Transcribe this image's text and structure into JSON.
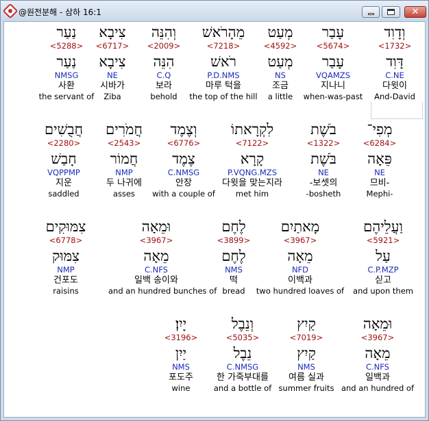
{
  "window": {
    "title": "@원전분해 - 삼하 16:1",
    "icon": "app-diamond-icon",
    "buttons": {
      "minimize": "minimize-icon",
      "maximize": "maximize-icon",
      "close": "close-icon",
      "close_glyph": "✕"
    }
  },
  "rows": [
    {
      "words": [
        {
          "heb1": "וְדָוִד",
          "strong": "<1732>",
          "heb2": "דָּוִד",
          "morph": "C.NE",
          "kor": "다윗이",
          "eng": "And-David",
          "selected": true
        },
        {
          "heb1": "עָבַר",
          "strong": "<5674>",
          "heb2": "עָבַר",
          "morph": "VQAMZS",
          "kor": "지나니",
          "eng": "when-was-past"
        },
        {
          "heb1": "מְעַט",
          "strong": "<4592>",
          "heb2": "מְעַט",
          "morph": "NS",
          "kor": "조금",
          "eng": "a little"
        },
        {
          "heb1": "מֵהָרֹאשׁ",
          "strong": "<7218>",
          "heb2": "רֹאשׁ",
          "morph": "P.D.NMS",
          "kor": "마루 턱을",
          "eng": "the top of the hill"
        },
        {
          "heb1": "וְהִנֵּה",
          "strong": "<2009>",
          "heb2": "הִנֵּה",
          "morph": "C.Q",
          "kor": "보라",
          "eng": "behold"
        },
        {
          "heb1": "צִיבָא",
          "strong": "<6717>",
          "heb2": "צִיבָא",
          "morph": "NE",
          "kor": "시바가",
          "eng": "Ziba"
        },
        {
          "heb1": "נַעַר",
          "strong": "<5288>",
          "heb2": "נַעַר",
          "morph": "NMSG",
          "kor": "사환",
          "eng": "the servant of"
        }
      ]
    },
    {
      "words": [
        {
          "heb1": "מְפִי־",
          "strong": "<6284>",
          "heb2": "פֵּאָה",
          "morph": "NE",
          "kor": "므비-",
          "eng": "Mephi-"
        },
        {
          "heb1": "בֹשֶׁת",
          "strong": "<1322>",
          "heb2": "בֹּשֶׁת",
          "morph": "NE",
          "kor": "-보셋의",
          "eng": "-bosheth"
        },
        {
          "heb1": "לִקְרָאתוֹ",
          "strong": "<7122>",
          "heb2": "קָרָא",
          "morph": "P.VQNG.MZS",
          "kor": "다윗을 맞는지라",
          "eng": "met him"
        },
        {
          "heb1": "וְצֶמֶד",
          "strong": "<6776>",
          "heb2": "צֶמֶד",
          "morph": "C.NMSG",
          "kor": "안장",
          "eng": "with a couple of"
        },
        {
          "heb1": "חֲמֹרִים",
          "strong": "<2543>",
          "heb2": "חֲמוֹר",
          "morph": "NMP",
          "kor": "두 나귀에",
          "eng": "asses"
        },
        {
          "heb1": "חֲבֻשִׁים",
          "strong": "<2280>",
          "heb2": "חָבַשׁ",
          "morph": "VQPPMP",
          "kor": "지운",
          "eng": "saddled"
        }
      ]
    },
    {
      "words": [
        {
          "heb1": "וַעֲלֵיהֶם",
          "strong": "<5921>",
          "heb2": "עַל",
          "morph": "C.P.MZP",
          "kor": "싣고",
          "eng": "and upon them"
        },
        {
          "heb1": "מָאתַיִם",
          "strong": "<3967>",
          "heb2": "מֵאָה",
          "morph": "NFD",
          "kor": "이백과",
          "eng": "two hundred loaves of"
        },
        {
          "heb1": "לֶחֶם",
          "strong": "<3899>",
          "heb2": "לֶחֶם",
          "morph": "NMS",
          "kor": "떡",
          "eng": "bread"
        },
        {
          "heb1": "וּמֵאָה",
          "strong": "<3967>",
          "heb2": "מֵאָה",
          "morph": "C.NFS",
          "kor": "일백 송이와",
          "eng": "and an hundred bunches of"
        },
        {
          "heb1": "צִמּוּקִים",
          "strong": "<6778>",
          "heb2": "צִמּוּק",
          "morph": "NMP",
          "kor": "건포도",
          "eng": "raisins"
        }
      ]
    },
    {
      "words": [
        {
          "heb1": "וּמֵאָה",
          "strong": "<3967>",
          "heb2": "מֵאָה",
          "morph": "C.NFS",
          "kor": "일백과",
          "eng": "and an hundred of"
        },
        {
          "heb1": "קַיִץ",
          "strong": "<7019>",
          "heb2": "קַיִץ",
          "morph": "NMS",
          "kor": "여름 실과",
          "eng": "summer fruits"
        },
        {
          "heb1": "וְנֵבֶל",
          "strong": "<5035>",
          "heb2": "נֵבֶל",
          "morph": "C.NMSG",
          "kor": "한 가죽부대를",
          "eng": "and a bottle of"
        },
        {
          "heb1": "יָיִן׃",
          "strong": "<3196>",
          "heb2": "יַיִן",
          "morph": "NMS",
          "kor": "포도주",
          "eng": "wine"
        }
      ]
    }
  ]
}
